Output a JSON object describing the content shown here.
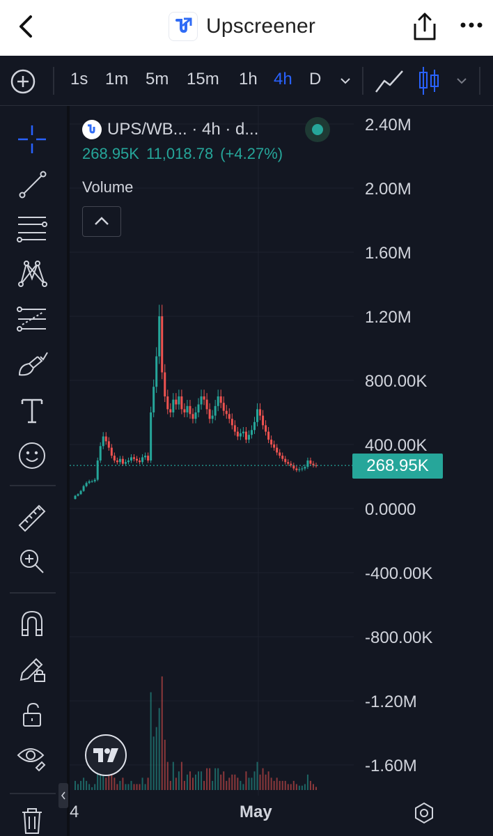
{
  "header": {
    "back_icon": "chevron-left-icon",
    "app_name": "Upscreener",
    "share_icon": "share-icon",
    "more_icon": "more-horizontal-icon"
  },
  "toolbar": {
    "timeframes": [
      "1s",
      "1m",
      "5m",
      "15m",
      "1h",
      "4h",
      "D"
    ],
    "active_timeframe": "4h",
    "accent": "#2962ff"
  },
  "sidebar": {
    "tools": [
      "crosshair",
      "trend-line",
      "fib-retracement",
      "pattern",
      "forecast",
      "brush",
      "text",
      "emoji",
      "ruler",
      "zoom-in",
      "magnet",
      "lock-drawing",
      "lock-all",
      "hide-drawings",
      "trash"
    ]
  },
  "legend": {
    "symbol": "UPS/WB... · 4h · d...",
    "volume_value": "268.95K",
    "price_value": "11,018.78",
    "change_pct": "(+4.27%)",
    "indicator": "Volume"
  },
  "price_tag": "268.95K",
  "colors": {
    "up": "#26a69a",
    "down": "#ef5350",
    "background": "#131722",
    "text": "#d1d4dc"
  },
  "chart_data": {
    "type": "line",
    "title": "",
    "series": [
      {
        "values": [
          60000,
          80000,
          90000,
          110000,
          140000,
          160000,
          170000,
          170000,
          180000,
          300000,
          390000,
          450000,
          420000,
          380000,
          330000,
          300000,
          290000,
          310000,
          280000,
          290000,
          300000,
          320000,
          310000,
          300000,
          290000,
          320000,
          330000,
          300000,
          600000,
          760000,
          950000,
          1200000,
          850000,
          700000,
          620000,
          600000,
          680000,
          650000,
          700000,
          620000,
          600000,
          640000,
          590000,
          560000,
          600000,
          650000,
          700000,
          680000,
          620000,
          560000,
          580000,
          640000,
          700000,
          660000,
          610000,
          590000,
          560000,
          520000,
          480000,
          450000,
          470000,
          480000,
          430000,
          460000,
          490000,
          540000,
          620000,
          580000,
          520000,
          480000,
          430000,
          400000,
          380000,
          350000,
          330000,
          310000,
          290000,
          280000,
          270000,
          250000,
          240000,
          245000,
          250000,
          260000,
          300000,
          280000,
          270000,
          268950
        ]
      }
    ],
    "y_ticks": [
      "2.40M",
      "2.00M",
      "1.60M",
      "1.20M",
      "800.00K",
      "400.00K",
      "0.0000",
      "-400.00K",
      "-800.00K",
      "-1.20M",
      "-1.60M"
    ],
    "ylim": [
      -1600000,
      2400000
    ],
    "x_ticks": [
      "4",
      "May"
    ],
    "last_value": 268950,
    "grid": true
  }
}
